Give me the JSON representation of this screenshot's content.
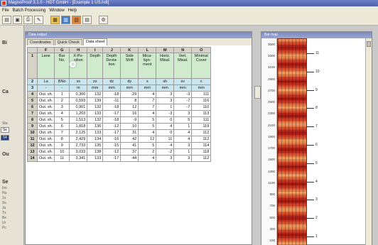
{
  "window": {
    "title": "MagnoProof 3.1.0 - HDT GmbH - [Example 1 US.hdt]"
  },
  "menu": [
    "File",
    "Batch Processing",
    "Window",
    "Help"
  ],
  "left": {
    "h1": "Bi",
    "h2": "Ca",
    "h3": "Ou",
    "h4": "Se",
    "sta": "Sta",
    "se_box": "Se",
    "box_54": "54",
    "notes": [
      "Ins",
      "Hu",
      "1x",
      "Ss",
      "Ju",
      "Tx",
      "Bx",
      "Ur",
      "Pc"
    ]
  },
  "data_window": {
    "title": "Data output",
    "tabs": [
      "Coordinates",
      "Quick Check",
      "Data sheet"
    ],
    "active_tab": "Data sheet",
    "columns": [
      "F",
      "G",
      "H",
      "I",
      "J",
      "K",
      "L",
      "M",
      "N",
      "O"
    ],
    "headers": [
      "Lane",
      "Bar No.",
      "X-Po-sition",
      "Depth",
      "Depth Devia-tion",
      "Side Shift",
      "Mica-lign-ment",
      "Horiz. Misal.",
      "Vert. Misal.",
      "Minimal Cover"
    ],
    "symbols": [
      "La",
      "BNo",
      "xs",
      "zs",
      "dz",
      "dy",
      "s",
      "sh",
      "sv",
      "c"
    ],
    "units": [
      "-",
      "-",
      "m",
      "mm",
      "mm",
      "mm",
      "mm",
      "mm",
      "mm",
      "mm"
    ],
    "header_row": "1",
    "symbol_row": "2",
    "unit_row": "3",
    "rows": [
      {
        "n": "4",
        "lane": "Out. sh.",
        "bar": "1",
        "x": "0,300",
        "d": "132",
        "dz": "-18",
        "dy": "29",
        "s": "4",
        "sh": "3",
        "sv": "-3",
        "c": "111"
      },
      {
        "n": "5",
        "lane": "Out. sh.",
        "bar": "2",
        "x": "0,593",
        "d": "139",
        "dz": "-11",
        "dy": "8",
        "s": "7",
        "sh": "3",
        "sv": "-7",
        "c": "116"
      },
      {
        "n": "6",
        "lane": "Out. sh.",
        "bar": "3",
        "x": "0,901",
        "d": "132",
        "dz": "-18",
        "dy": "12",
        "s": "7",
        "sh": "1",
        "sv": "-7",
        "c": "110"
      },
      {
        "n": "7",
        "lane": "Out. sh.",
        "bar": "4",
        "x": "1,203",
        "d": "133",
        "dz": "-17",
        "dy": "16",
        "s": "4",
        "sh": "-3",
        "sv": "3",
        "c": "113"
      },
      {
        "n": "8",
        "lane": "Out. sh.",
        "bar": "5",
        "x": "1,513",
        "d": "132",
        "dz": "-18",
        "dy": "-9",
        "s": "5",
        "sh": "0",
        "sv": "5",
        "c": "111"
      },
      {
        "n": "9",
        "lane": "Out. sh.",
        "bar": "6",
        "x": "1,818",
        "d": "136",
        "dz": "-12",
        "dy": "10",
        "s": "5",
        "sh": "4",
        "sv": "1",
        "c": "119"
      },
      {
        "n": "10",
        "lane": "Out. sh.",
        "bar": "7",
        "x": "2,125",
        "d": "133",
        "dz": "-17",
        "dy": "31",
        "s": "4",
        "sh": "0",
        "sv": "4",
        "c": "112"
      },
      {
        "n": "11",
        "lane": "Out. sh.",
        "bar": "8",
        "x": "2,429",
        "d": "134",
        "dz": "-16",
        "dy": "42",
        "s": "12",
        "sh": "11",
        "sv": "4",
        "c": "112"
      },
      {
        "n": "12",
        "lane": "Out. sh.",
        "bar": "9",
        "x": "2,733",
        "d": "135",
        "dz": "-15",
        "dy": "41",
        "s": "5",
        "sh": "4",
        "sv": "3",
        "c": "114"
      },
      {
        "n": "13",
        "lane": "Out. sh.",
        "bar": "10",
        "x": "3,033",
        "d": "138",
        "dz": "-12",
        "dy": "37",
        "s": "2",
        "sh": "-2",
        "sv": "1",
        "c": "118"
      },
      {
        "n": "14",
        "lane": "Out. sh.",
        "bar": "11",
        "x": "3,341",
        "d": "133",
        "dz": "-17",
        "dy": "44",
        "s": "4",
        "sh": "3",
        "sv": "3",
        "c": "112"
      }
    ]
  },
  "scan_window": {
    "title": "Bar map",
    "y_ticks": [
      "3500",
      "3300",
      "3100",
      "2900",
      "2700",
      "2500",
      "2300",
      "2100",
      "1900",
      "1700",
      "1500",
      "1300",
      "1100",
      "900",
      "700",
      "500",
      "300",
      "100"
    ],
    "bar_labels": [
      "11",
      "10",
      "9",
      "8",
      "7",
      "6",
      "5",
      "4",
      "3",
      "2",
      "1"
    ]
  },
  "colors": {
    "header_green": "#cfeacd",
    "unit_blue": "#cbe5ee",
    "heat_red": "#a5140e",
    "title_blue": "#4d62ad"
  }
}
